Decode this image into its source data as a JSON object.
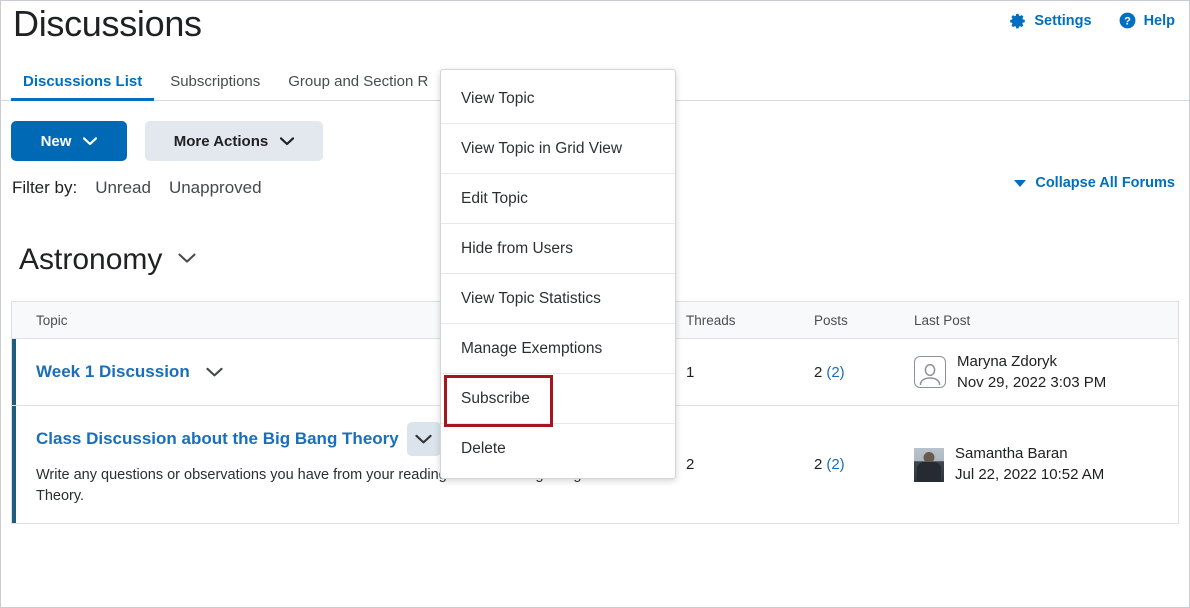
{
  "header": {
    "title": "Discussions",
    "actions": [
      {
        "label": "Settings",
        "icon": "gear-icon"
      },
      {
        "label": "Help",
        "icon": "help-circle-icon"
      }
    ]
  },
  "tabs": [
    {
      "label": "Discussions List",
      "active": true
    },
    {
      "label": "Subscriptions",
      "active": false
    },
    {
      "label": "Group and Section R",
      "active": false
    }
  ],
  "toolbar": {
    "new_label": "New",
    "more_actions_label": "More Actions"
  },
  "filter": {
    "label": "Filter by:",
    "options": [
      "Unread",
      "Unapproved"
    ],
    "collapse_all_label": "Collapse All Forums"
  },
  "forum": {
    "name": "Astronomy"
  },
  "table": {
    "columns": [
      "Topic",
      "Threads",
      "Posts",
      "Last Post"
    ],
    "rows": [
      {
        "topic": "Week 1 Discussion",
        "description": "",
        "threads": "1",
        "posts": "2",
        "posts_unread": "(2)",
        "last_post_name": "Maryna Zdoryk",
        "last_post_date": "Nov 29, 2022 3:03 PM",
        "avatar": "default-person-avatar"
      },
      {
        "topic": "Class Discussion about the Big Bang Theory",
        "description": "Write any questions or observations you have from your readings about the Big Bang Theory.",
        "threads": "2",
        "posts": "2",
        "posts_unread": "(2)",
        "last_post_name": "Samantha Baran",
        "last_post_date": "Jul 22, 2022 10:52 AM",
        "avatar": "photo-avatar"
      }
    ]
  },
  "context_menu": {
    "items": [
      {
        "label": "View Topic",
        "highlighted": false
      },
      {
        "label": "View Topic in Grid View",
        "highlighted": false
      },
      {
        "label": "Edit Topic",
        "highlighted": false
      },
      {
        "label": "Hide from Users",
        "highlighted": false
      },
      {
        "label": "View Topic Statistics",
        "highlighted": false
      },
      {
        "label": "Manage Exemptions",
        "highlighted": false
      },
      {
        "label": "Subscribe",
        "highlighted": true
      },
      {
        "label": "Delete",
        "highlighted": false
      }
    ]
  },
  "colors": {
    "accent_blue": "#006fbf",
    "primary_button": "#0069b5",
    "link_blue": "#1a6fb8",
    "row_accent": "#205c7d",
    "annotation_red": "#a31621"
  }
}
